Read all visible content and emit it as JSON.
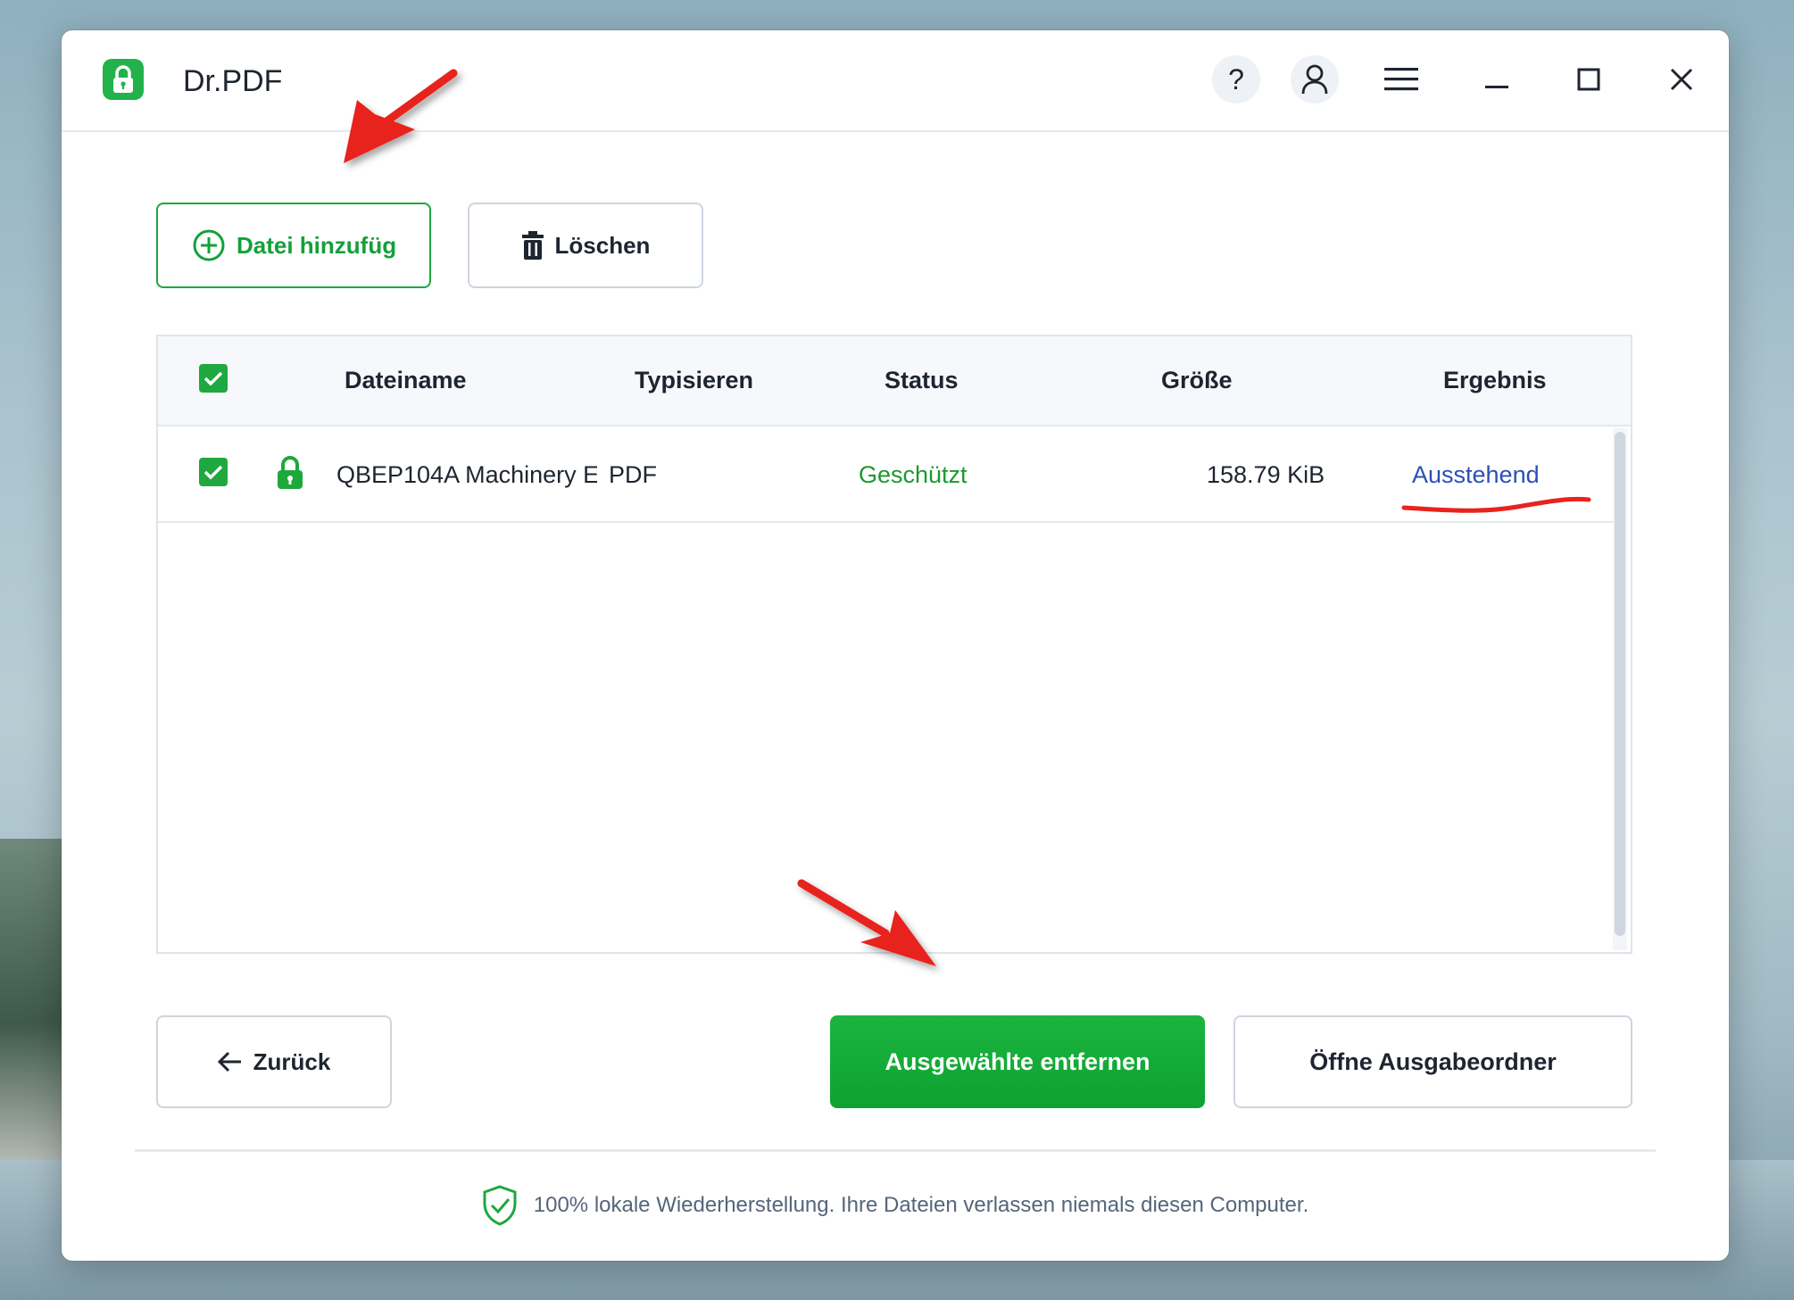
{
  "app": {
    "title": "Dr.PDF"
  },
  "titlebar": {
    "help_label": "?",
    "icons": [
      "lock-icon",
      "help-icon",
      "user-icon",
      "menu-icon",
      "minimize-icon",
      "maximize-icon",
      "close-icon"
    ]
  },
  "toolbar": {
    "add_label": "Datei hinzufügen",
    "delete_label": "Löschen"
  },
  "table": {
    "columns": [
      "Dateiname",
      "Typisieren",
      "Status",
      "Größe",
      "Ergebnis"
    ],
    "rows": [
      {
        "name": "QBEP104A Machinery E",
        "type": "PDF",
        "status": "Geschützt",
        "size": "158.79 KiB",
        "result": "Ausstehend",
        "checked": true
      }
    ]
  },
  "actions": {
    "back_label": "Zurück",
    "remove_label": "Ausgewählte entfernen",
    "open_label": "Öffne Ausgabeordner"
  },
  "footer": {
    "text": "100% lokale Wiederherstellung. Ihre Dateien verlassen niemals diesen Computer."
  },
  "colors": {
    "accent_green": "#1ea83c",
    "status_green": "#1b9a2f",
    "result_blue": "#2b4fb6",
    "annotation_red": "#e8231d"
  }
}
